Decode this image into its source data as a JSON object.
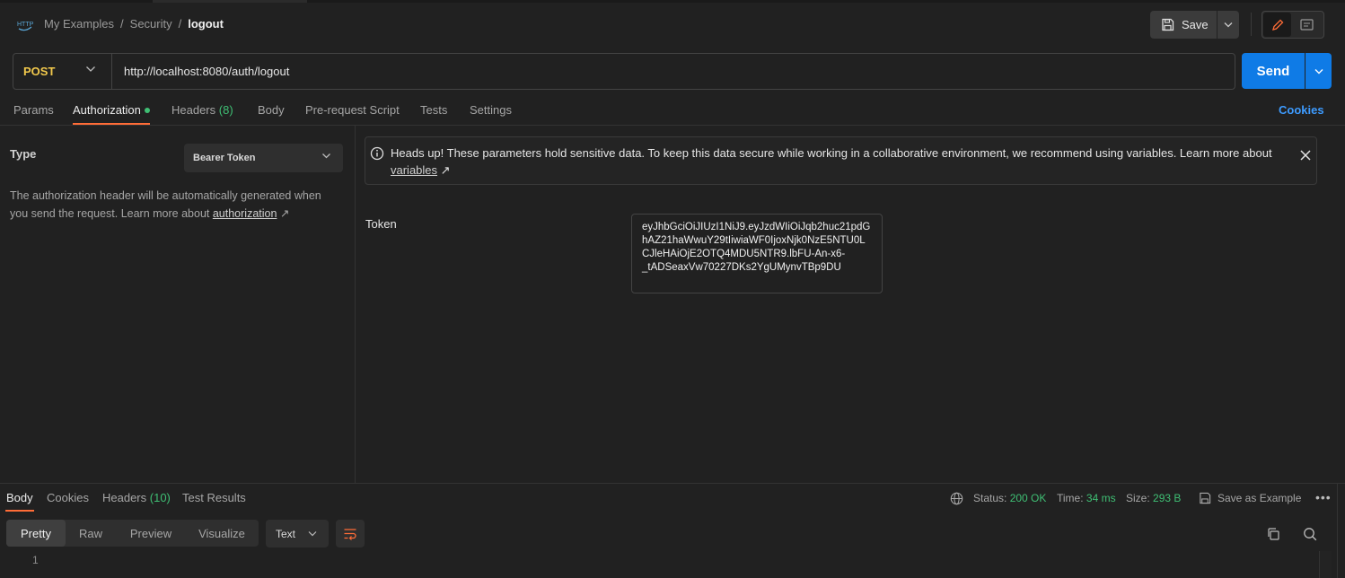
{
  "breadcrumb": {
    "icon_text": "HTTP",
    "items": [
      "My Examples",
      "/",
      "Security",
      "/"
    ],
    "current": "logout"
  },
  "toolbar": {
    "save_label": "Save"
  },
  "request": {
    "method": "POST",
    "url": "http://localhost:8080/auth/logout",
    "send_label": "Send"
  },
  "request_tabs": {
    "params": "Params",
    "authorization": "Authorization",
    "headers": "Headers",
    "headers_count": "(8)",
    "body": "Body",
    "prerequest": "Pre-request Script",
    "tests": "Tests",
    "settings": "Settings",
    "cookies": "Cookies"
  },
  "auth": {
    "type_label": "Type",
    "type_value": "Bearer Token",
    "description": "The authorization header will be automatically generated when you send the request. Learn more about ",
    "description_link": "authorization",
    "link_arrow": "↗",
    "notice_text": "Heads up! These parameters hold sensitive data. To keep this data secure while working in a collaborative environment, we recommend using variables. Learn more about ",
    "notice_link": "variables",
    "token_label": "Token",
    "token_value": "eyJhbGciOiJIUzI1NiJ9.eyJzdWIiOiJqb2huc21pdGhAZ21haWwuY29tIiwiaWF0IjoxNjk0NzE5NTU0LCJleHAiOjE2OTQ4MDU5NTR9.lbFU-An-x6-\n_tADSeaxVw70227DKs2YgUMynvTBp9DU"
  },
  "response": {
    "tabs": {
      "body": "Body",
      "cookies": "Cookies",
      "headers": "Headers",
      "headers_count": "(10)",
      "test_results": "Test Results"
    },
    "status_label": "Status:",
    "status_value": "200 OK",
    "time_label": "Time:",
    "time_value": "34 ms",
    "size_label": "Size:",
    "size_value": "293 B",
    "save_example": "Save as Example",
    "more": "•••",
    "view_modes": [
      "Pretty",
      "Raw",
      "Preview",
      "Visualize"
    ],
    "active_view": "Pretty",
    "format": "Text",
    "line_number": "1"
  },
  "colors": {
    "accent_orange": "#ff6c37",
    "send_blue": "#0f7be6",
    "link_blue": "#3d9bff",
    "method_yellow": "#f2c94c",
    "status_green": "#3fbf74"
  }
}
